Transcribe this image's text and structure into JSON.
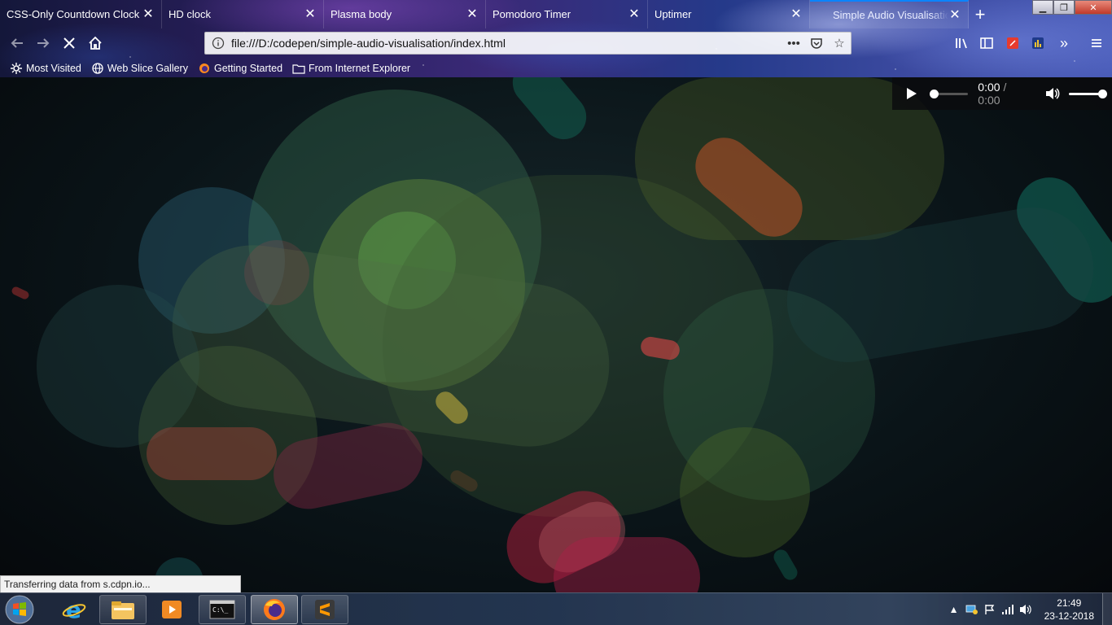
{
  "tabs": [
    {
      "label": "CSS-Only Countdown Clock"
    },
    {
      "label": "HD clock"
    },
    {
      "label": "Plasma body"
    },
    {
      "label": "Pomodoro Timer"
    },
    {
      "label": "Uptimer"
    },
    {
      "label": "Simple Audio Visualisation"
    }
  ],
  "url": "file:///D:/codepen/simple-audio-visualisation/index.html",
  "bookmarks": [
    {
      "label": "Most Visited"
    },
    {
      "label": "Web Slice Gallery"
    },
    {
      "label": "Getting Started"
    },
    {
      "label": "From Internet Explorer"
    }
  ],
  "audio": {
    "current": "0:00",
    "sep": "/",
    "duration": "0:00",
    "volume_fraction": 1.0,
    "progress_fraction": 0
  },
  "status": "Transferring data from s.cdpn.io...",
  "clock": {
    "time": "21:49",
    "date": "23-12-2018"
  },
  "colors": {
    "accent": "#0a84ff"
  }
}
